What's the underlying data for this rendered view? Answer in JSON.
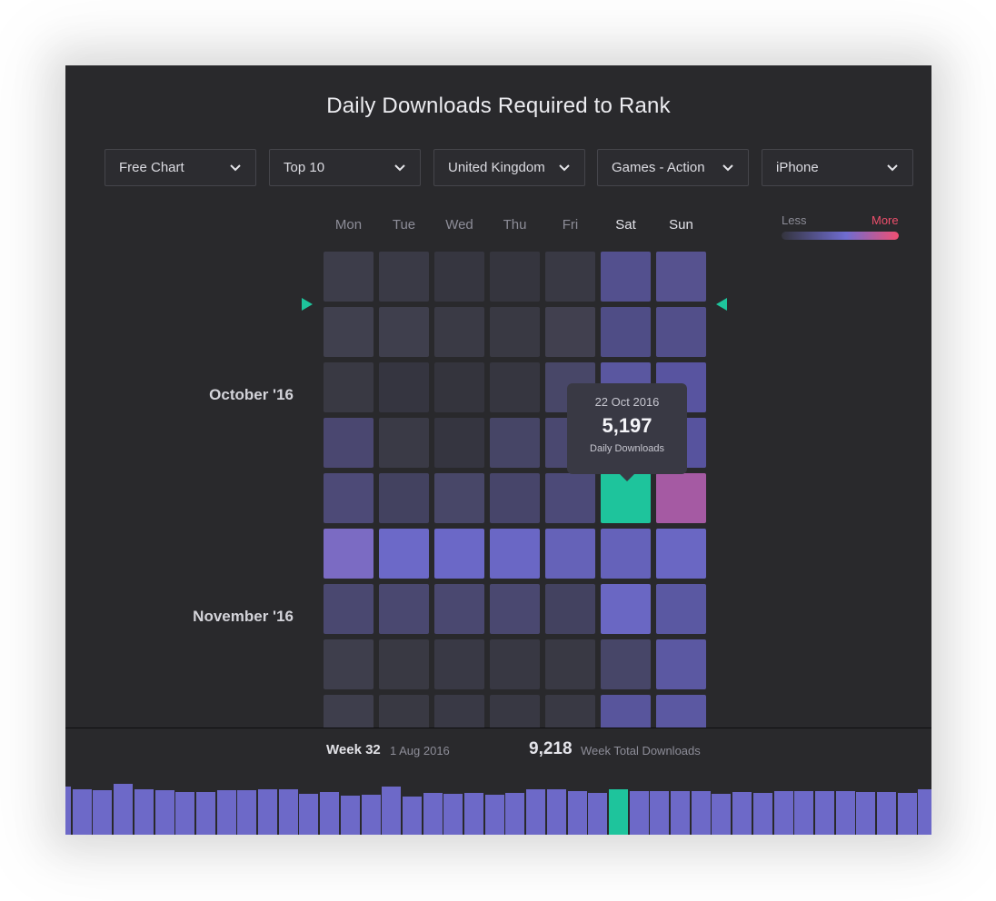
{
  "title": "Daily Downloads Required to Rank",
  "filters": [
    {
      "label": "Free Chart"
    },
    {
      "label": "Top 10"
    },
    {
      "label": "United Kingdom"
    },
    {
      "label": "Games - Action"
    },
    {
      "label": "iPhone"
    }
  ],
  "days": [
    "Mon",
    "Tue",
    "Wed",
    "Thu",
    "Fri",
    "Sat",
    "Sun"
  ],
  "legend": {
    "less": "Less",
    "more": "More"
  },
  "months": [
    "October '16",
    "November '16"
  ],
  "colors": {
    "panel_bg": "#29292c",
    "selected": "#1ec49c",
    "highlight_pink": "#a55aa3",
    "bar": "#6d69c8",
    "legend_more": "#ee4f6c"
  },
  "calendar": {
    "row_colors": [
      [
        "#3d3d4a",
        "#3b3b47",
        "#383842",
        "#373741",
        "#3b3b48",
        "#525090",
        "#56528f"
      ],
      [
        "#3d3d4a",
        "#3a3a46",
        "#363640",
        "#35353e",
        "#393944",
        "#53508e",
        "#56528f"
      ],
      [
        "#40404e",
        "#3f3f4d",
        "#3a3a45",
        "#393943",
        "#41404f",
        "#4f4d86",
        "#524f8a"
      ],
      [
        "#393943",
        "#353540",
        "#34343d",
        "#363640",
        "#484768",
        "#5a57a0",
        "#5854a0"
      ],
      [
        "#4a4770",
        "#3a3a46",
        "#353540",
        "#464566",
        "#4a4870",
        "#5b58a2",
        "#57539e"
      ],
      [
        "#4d4a77",
        "#434260",
        "#484768",
        "#47456a",
        "#4c4a78",
        "#1ec49c",
        "#a55aa3"
      ],
      [
        "#7b6bc3",
        "#6c69c8",
        "#6b68c7",
        "#6a67c5",
        "#6562b8",
        "#6562ba",
        "#6a67c3"
      ],
      [
        "#4a4870",
        "#4a4870",
        "#4a4870",
        "#4a4870",
        "#434260",
        "#6a67c3",
        "#5a58a2"
      ],
      [
        "#3e3e4c",
        "#393943",
        "#393945",
        "#383843",
        "#393944",
        "#474668",
        "#5b58a2"
      ],
      [
        "#3e3e4c",
        "#393943",
        "#393945",
        "#383843",
        "#393944",
        "#58559c",
        "#5b58a2"
      ]
    ]
  },
  "tooltip": {
    "date": "22 Oct 2016",
    "value": "5,197",
    "label": "Daily Downloads"
  },
  "footer": {
    "week_label": "Week 32",
    "week_date": "1 Aug 2016",
    "week_total": "9,218",
    "week_total_label": "Week Total Downloads"
  },
  "weekly_bars": {
    "selected_index": 27,
    "values": [
      53,
      50,
      49,
      56,
      50,
      49,
      47,
      47,
      49,
      49,
      50,
      50,
      45,
      47,
      43,
      44,
      53,
      42,
      46,
      45,
      46,
      44,
      46,
      50,
      50,
      48,
      46,
      50,
      48,
      48,
      48,
      48,
      45,
      47,
      46,
      48,
      48,
      48,
      48,
      47,
      47,
      46,
      50
    ]
  }
}
